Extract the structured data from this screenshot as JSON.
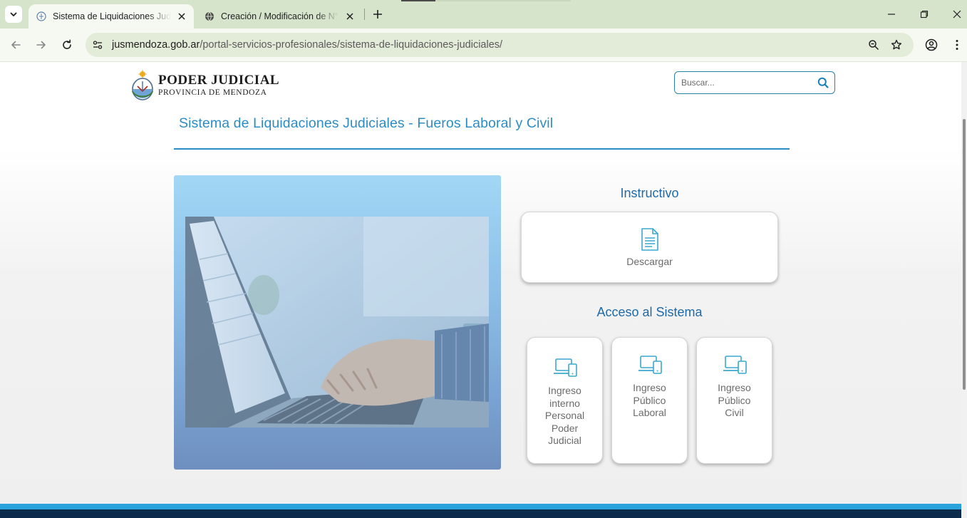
{
  "browser": {
    "tabs": [
      {
        "title": "Sistema de Liquidaciones Judiciales",
        "active": true
      },
      {
        "title": "Creación / Modificación de N° Expediente",
        "active": false
      }
    ],
    "url_host": "jusmendoza.gob.ar",
    "url_path": "/portal-servicios-profesionales/sistema-de-liquidaciones-judiciales/"
  },
  "header": {
    "logo_line1": "PODER JUDICIAL",
    "logo_line2": "PROVINCIA DE MENDOZA",
    "search_placeholder": "Buscar..."
  },
  "page": {
    "title": "Sistema de Liquidaciones Judiciales - Fueros Laboral y Civil",
    "instructivo_heading": "Instructivo",
    "download_label": "Descargar",
    "access_heading": "Acceso al Sistema",
    "access_cards": [
      {
        "label": "Ingreso interno Personal Poder Judicial"
      },
      {
        "label": "Ingreso Público Laboral"
      },
      {
        "label": "Ingreso Público Civil"
      }
    ]
  },
  "colors": {
    "accent": "#2c8dc5",
    "heading": "#1f6aa6",
    "chrome": "#d5e4cb",
    "footer": "#0c2a4c"
  }
}
